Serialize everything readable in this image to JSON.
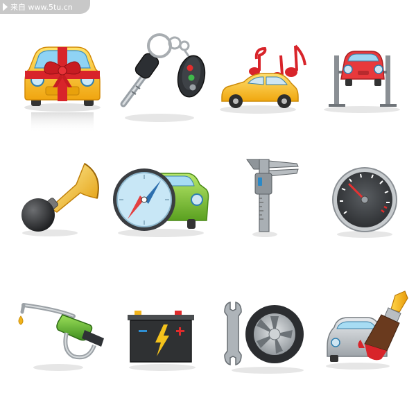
{
  "watermark": {
    "text": "来自 www.5tu.cn"
  },
  "icons": [
    {
      "name": "car-with-gift-bow-icon"
    },
    {
      "name": "car-key-fob-icon"
    },
    {
      "name": "car-audio-music-notes-icon"
    },
    {
      "name": "car-lift-icon"
    },
    {
      "name": "air-horn-icon"
    },
    {
      "name": "car-navigation-compass-icon"
    },
    {
      "name": "caliper-icon"
    },
    {
      "name": "speedometer-gauge-icon"
    },
    {
      "name": "fuel-nozzle-icon"
    },
    {
      "name": "car-battery-icon"
    },
    {
      "name": "wrench-and-tire-icon"
    },
    {
      "name": "car-paint-brush-icon"
    }
  ],
  "colors": {
    "car_yellow": "#f4c21c",
    "bow_red": "#d8242a",
    "horn_gold": "#f0a80c",
    "car_green": "#7ec632",
    "nozzle_green": "#5db133",
    "lift_gray": "#8a8f94",
    "battery_dark": "#2f3133"
  }
}
